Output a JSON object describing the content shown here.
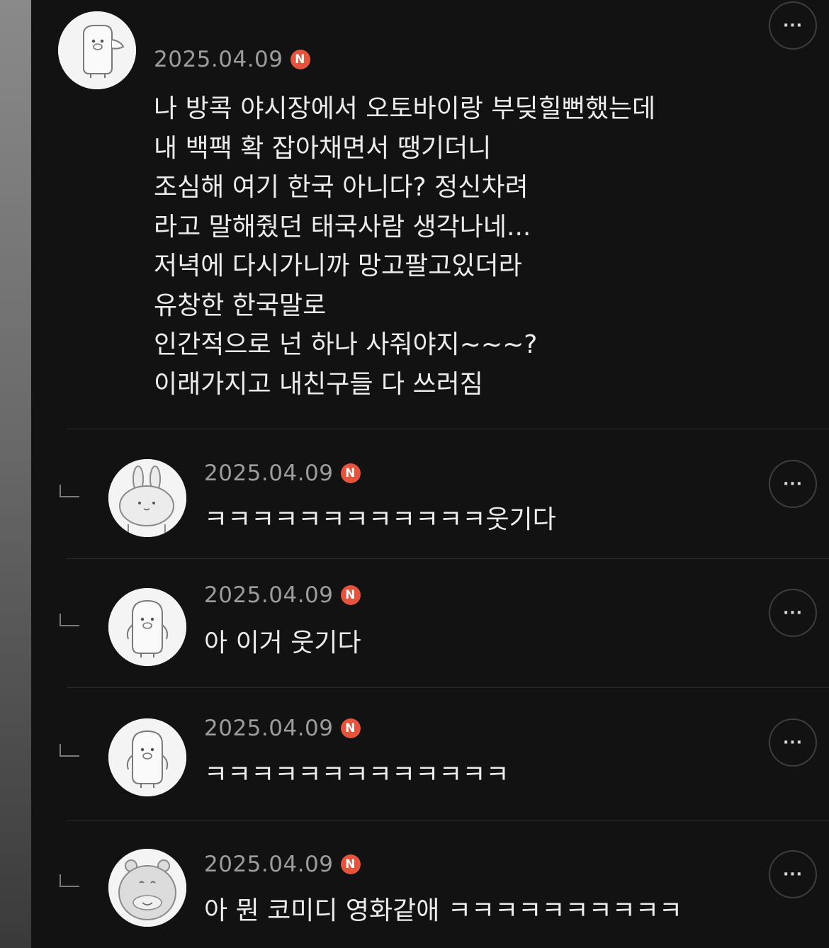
{
  "comment": {
    "date": "2025.04.09",
    "badge": "N",
    "text": "나 방콕 야시장에서 오토바이랑 부딪힐뻔했는데\n내 백팩 확 잡아채면서 땡기더니\n조심해 여기 한국 아니다? 정신차려\n라고 말해줬던 태국사람 생각나네...\n저녁에 다시가니까 망고팔고있더라\n유창한 한국말로\n인간적으로 넌 하나 사줘야지~~~?\n이래가지고 내친구들 다 쓰러짐",
    "more_label": "···",
    "avatar_icon": "seal-character-icon"
  },
  "replies": [
    {
      "date": "2025.04.09",
      "badge": "N",
      "text": "ㅋㅋㅋㅋㅋㅋㅋㅋㅋㅋㅋㅋ웃기다",
      "more_label": "···",
      "avatar_icon": "rabbit-character-icon"
    },
    {
      "date": "2025.04.09",
      "badge": "N",
      "text": "아 이거 웃기다",
      "more_label": "···",
      "avatar_icon": "penguin-character-icon"
    },
    {
      "date": "2025.04.09",
      "badge": "N",
      "text": "ㅋㅋㅋㅋㅋㅋㅋㅋㅋㅋㅋㅋㅋ",
      "more_label": "···",
      "avatar_icon": "penguin-character-icon"
    },
    {
      "date": "2025.04.09",
      "badge": "N",
      "text": "아 뭔 코미디 영화같애 ㅋㅋㅋㅋㅋㅋㅋㅋㅋㅋ",
      "more_label": "···",
      "avatar_icon": "bear-character-icon"
    }
  ],
  "colors": {
    "background": "#121212",
    "text": "#ececec",
    "date": "#9c9c9c",
    "badge": "#e5533d"
  }
}
